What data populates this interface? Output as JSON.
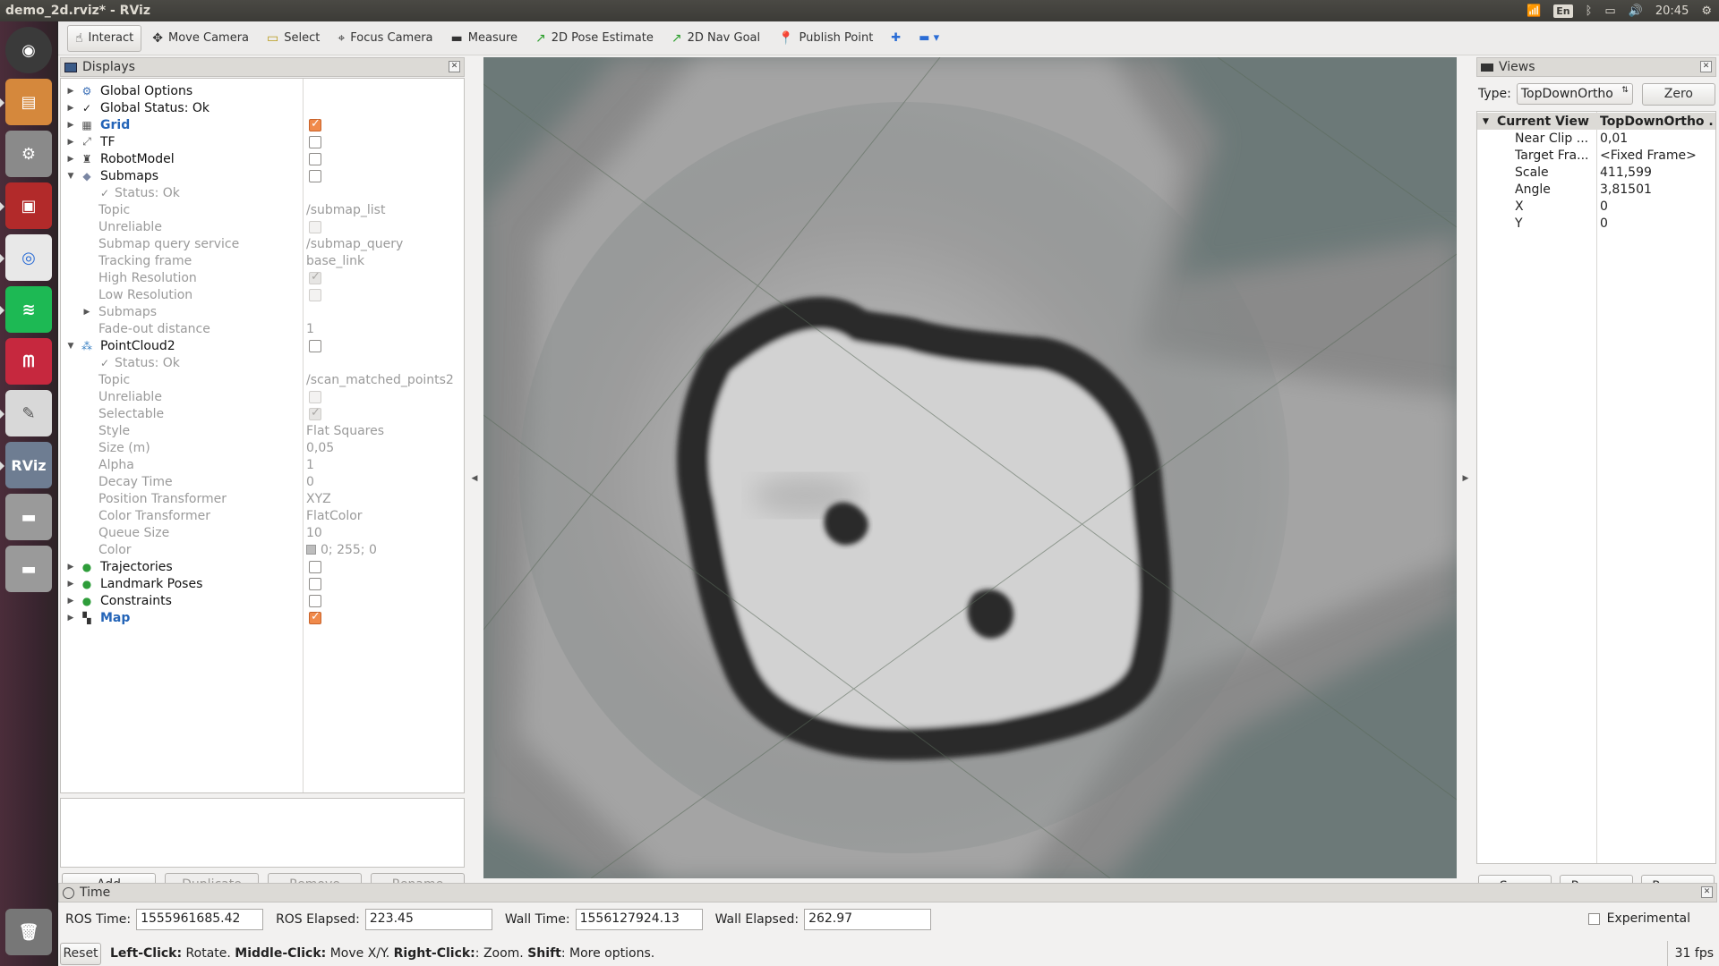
{
  "window_title": "demo_2d.rviz* - RViz",
  "system_tray": {
    "language": "En",
    "clock": "20:45"
  },
  "toolbar": {
    "tools": [
      {
        "label": "Interact",
        "icon": "hand-icon",
        "active": true
      },
      {
        "label": "Move Camera",
        "icon": "move-camera-icon"
      },
      {
        "label": "Select",
        "icon": "select-icon"
      },
      {
        "label": "Focus Camera",
        "icon": "focus-camera-icon"
      },
      {
        "label": "Measure",
        "icon": "ruler-icon"
      },
      {
        "label": "2D Pose Estimate",
        "icon": "green-arrow-icon"
      },
      {
        "label": "2D Nav Goal",
        "icon": "green-arrow-icon"
      },
      {
        "label": "Publish Point",
        "icon": "map-pin-icon"
      }
    ]
  },
  "displays": {
    "title": "Displays",
    "rows": [
      {
        "label": "Global Options",
        "indent": 0,
        "arrow": "▶",
        "icon": "⚙",
        "icon_color": "#3b6fb6",
        "style": "top"
      },
      {
        "label": "Global Status: Ok",
        "indent": 0,
        "arrow": "▶",
        "icon": "✓",
        "icon_color": "#222",
        "style": "top"
      },
      {
        "label": "Grid",
        "indent": 0,
        "arrow": "▶",
        "icon": "▦",
        "icon_color": "#555",
        "style": "blue",
        "checkbox": "checked"
      },
      {
        "label": "TF",
        "indent": 0,
        "arrow": "▶",
        "icon": "⤢",
        "icon_color": "#555",
        "style": "top",
        "checkbox": "empty"
      },
      {
        "label": "RobotModel",
        "indent": 0,
        "arrow": "▶",
        "icon": "♜",
        "icon_color": "#444",
        "style": "top",
        "checkbox": "empty"
      },
      {
        "label": "Submaps",
        "indent": 0,
        "arrow": "▼",
        "icon": "◆",
        "icon_color": "#7a86a3",
        "style": "top",
        "checkbox": "empty"
      },
      {
        "label": "Status: Ok",
        "indent": 1,
        "icon": "✓",
        "icon_color": "#888",
        "style": "child"
      },
      {
        "label": "Topic",
        "indent": 1,
        "style": "child",
        "value": "/submap_list"
      },
      {
        "label": "Unreliable",
        "indent": 1,
        "style": "child",
        "checkbox": "dis"
      },
      {
        "label": "Submap query service",
        "indent": 1,
        "style": "child",
        "value": "/submap_query"
      },
      {
        "label": "Tracking frame",
        "indent": 1,
        "style": "child",
        "value": "base_link"
      },
      {
        "label": "High Resolution",
        "indent": 1,
        "style": "child",
        "checkbox": "dis-checked"
      },
      {
        "label": "Low Resolution",
        "indent": 1,
        "style": "child",
        "checkbox": "dis"
      },
      {
        "label": "Submaps",
        "indent": 1,
        "arrow": "▶",
        "style": "child"
      },
      {
        "label": "Fade-out distance",
        "indent": 1,
        "style": "child",
        "value": "1"
      },
      {
        "label": "PointCloud2",
        "indent": 0,
        "arrow": "▼",
        "icon": "⁂",
        "icon_color": "#3b82c4",
        "style": "top",
        "checkbox": "empty"
      },
      {
        "label": "Status: Ok",
        "indent": 1,
        "icon": "✓",
        "icon_color": "#888",
        "style": "child"
      },
      {
        "label": "Topic",
        "indent": 1,
        "style": "child",
        "value": "/scan_matched_points2"
      },
      {
        "label": "Unreliable",
        "indent": 1,
        "style": "child",
        "checkbox": "dis"
      },
      {
        "label": "Selectable",
        "indent": 1,
        "style": "child",
        "checkbox": "dis-checked"
      },
      {
        "label": "Style",
        "indent": 1,
        "style": "child",
        "value": "Flat Squares"
      },
      {
        "label": "Size (m)",
        "indent": 1,
        "style": "child",
        "value": "0,05"
      },
      {
        "label": "Alpha",
        "indent": 1,
        "style": "child",
        "value": "1"
      },
      {
        "label": "Decay Time",
        "indent": 1,
        "style": "child",
        "value": "0"
      },
      {
        "label": "Position Transformer",
        "indent": 1,
        "style": "child",
        "value": "XYZ"
      },
      {
        "label": "Color Transformer",
        "indent": 1,
        "style": "child",
        "value": "FlatColor"
      },
      {
        "label": "Queue Size",
        "indent": 1,
        "style": "child",
        "value": "10"
      },
      {
        "label": "Color",
        "indent": 1,
        "style": "child",
        "value": "0; 255; 0",
        "swatch": true
      },
      {
        "label": "Trajectories",
        "indent": 0,
        "arrow": "▶",
        "icon": "●",
        "icon_color": "#2e9d3a",
        "style": "top",
        "checkbox": "empty"
      },
      {
        "label": "Landmark Poses",
        "indent": 0,
        "arrow": "▶",
        "icon": "●",
        "icon_color": "#2e9d3a",
        "style": "top",
        "checkbox": "empty"
      },
      {
        "label": "Constraints",
        "indent": 0,
        "arrow": "▶",
        "icon": "●",
        "icon_color": "#2e9d3a",
        "style": "top",
        "checkbox": "empty"
      },
      {
        "label": "Map",
        "indent": 0,
        "arrow": "▶",
        "icon": "▚",
        "icon_color": "#333",
        "style": "blue",
        "checkbox": "checked"
      }
    ],
    "buttons": {
      "add": "Add",
      "duplicate": "Duplicate",
      "remove": "Remove",
      "rename": "Rename"
    }
  },
  "views": {
    "title": "Views",
    "type_label": "Type:",
    "type_value": "TopDownOrtho",
    "zero": "Zero",
    "header": {
      "key": "Current View",
      "value": "TopDownOrtho ..."
    },
    "props": [
      {
        "key": "Near Clip ...",
        "value": "0,01"
      },
      {
        "key": "Target Fra...",
        "value": "<Fixed Frame>"
      },
      {
        "key": "Scale",
        "value": "411,599"
      },
      {
        "key": "Angle",
        "value": "3,81501"
      },
      {
        "key": "X",
        "value": "0"
      },
      {
        "key": "Y",
        "value": "0"
      }
    ],
    "buttons": {
      "save": "Save",
      "remove": "Remove",
      "rename": "Rename"
    }
  },
  "time": {
    "title": "Time",
    "ros_time_label": "ROS Time:",
    "ros_time": "1555961685.42",
    "ros_elapsed_label": "ROS Elapsed:",
    "ros_elapsed": "223.45",
    "wall_time_label": "Wall Time:",
    "wall_time": "1556127924.13",
    "wall_elapsed_label": "Wall Elapsed:",
    "wall_elapsed": "262.97",
    "experimental": "Experimental"
  },
  "status": {
    "reset": "Reset",
    "hint": [
      {
        "b": "Left-Click:",
        "t": " Rotate. "
      },
      {
        "b": "Middle-Click:",
        "t": " Move X/Y. "
      },
      {
        "b": "Right-Click:",
        "t": ": Zoom. "
      },
      {
        "b": "Shift",
        "t": ": More options."
      }
    ],
    "fps": "31 fps"
  },
  "colors": {
    "viewport_bg": "#6c7978",
    "map_free": "#d3d3d3",
    "map_wall": "#2c2c2c",
    "accent_checkbox": "#f08a4b",
    "bold_blue": "#2565b8"
  }
}
